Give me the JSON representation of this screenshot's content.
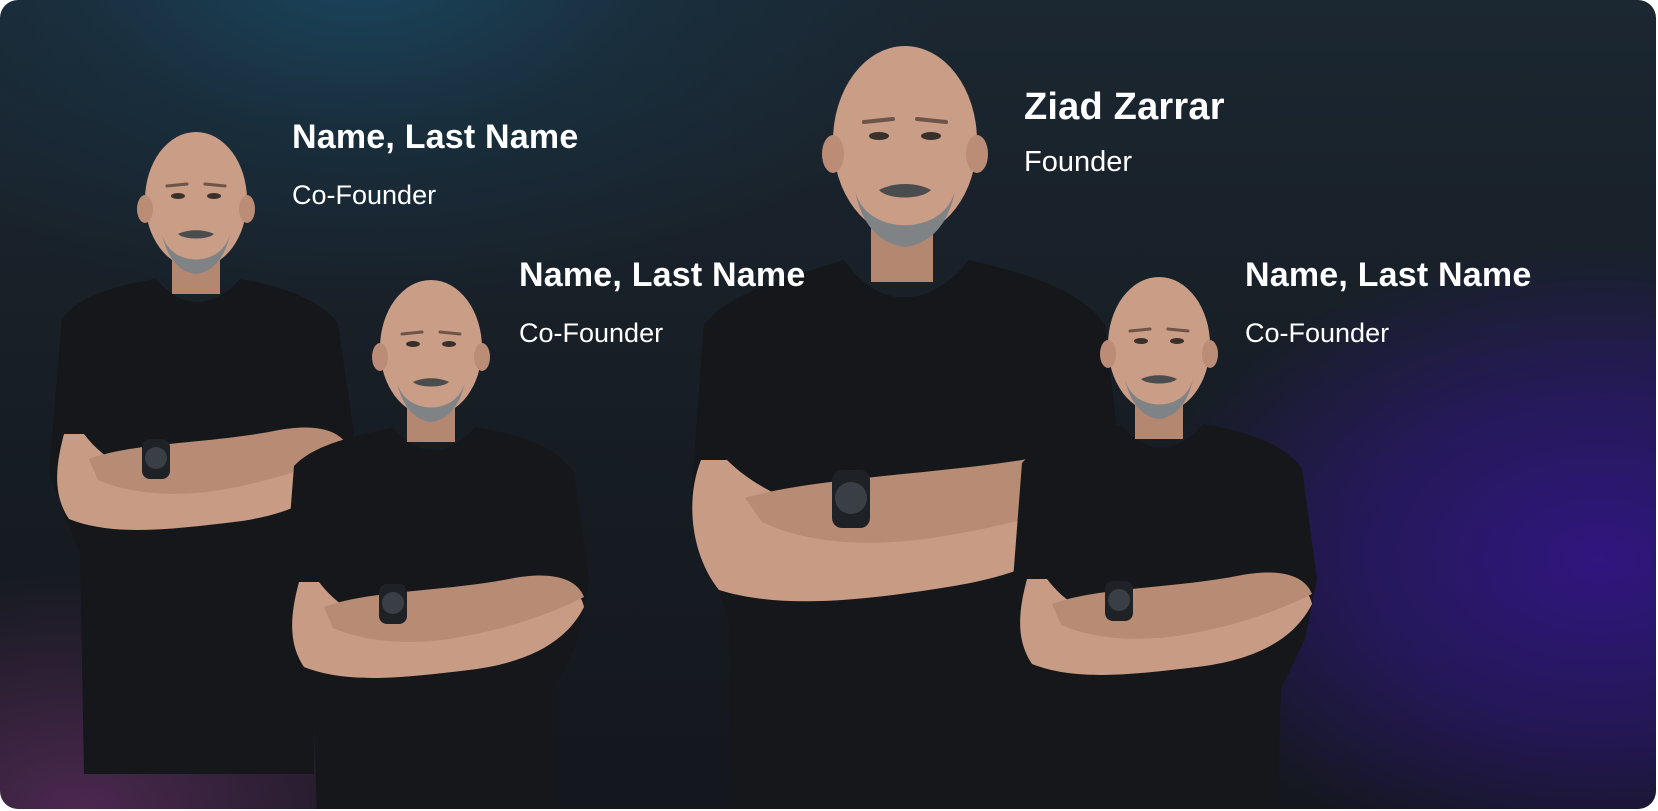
{
  "team": [
    {
      "name": "Name, Last Name",
      "role": "Co-Founder"
    },
    {
      "name": "Name, Last Name",
      "role": "Co-Founder"
    },
    {
      "name": "Ziad Zarrar",
      "role": "Founder"
    },
    {
      "name": "Name, Last Name",
      "role": "Co-Founder"
    }
  ],
  "colors": {
    "background_top": "#1b2731",
    "background_bottom": "#14171d",
    "accent_purple": "#311684",
    "text": "#ffffff",
    "shirt": "#15171a",
    "skin": "#c79b84"
  }
}
